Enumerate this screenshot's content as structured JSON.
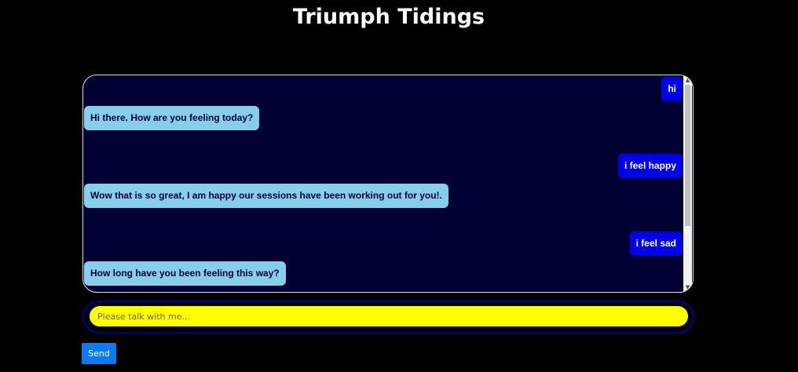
{
  "header": {
    "title": "Triumph Tidings"
  },
  "chat": {
    "messages": [
      {
        "sender": "user",
        "text": "hi"
      },
      {
        "sender": "bot",
        "text": "Hi there. How are you feeling today?"
      },
      {
        "sender": "user",
        "text": "i feel happy"
      },
      {
        "sender": "bot",
        "text": "Wow that is so great, I am happy our sessions have been working out for you!."
      },
      {
        "sender": "user",
        "text": "i feel sad"
      },
      {
        "sender": "bot",
        "text": "How long have you been feeling this way?"
      }
    ]
  },
  "composer": {
    "value": "",
    "placeholder": "Please talk with me...",
    "send_label": "Send"
  },
  "colors": {
    "page_background": "#000000",
    "chat_background": "#000033",
    "bot_bubble": "#87ceeb",
    "user_bubble": "#0000e6",
    "input_background": "#ffff00",
    "send_button": "#0a7cf0"
  },
  "icons": {
    "scroll_up": "scroll-up-arrow-icon",
    "scroll_down": "scroll-down-arrow-icon"
  }
}
